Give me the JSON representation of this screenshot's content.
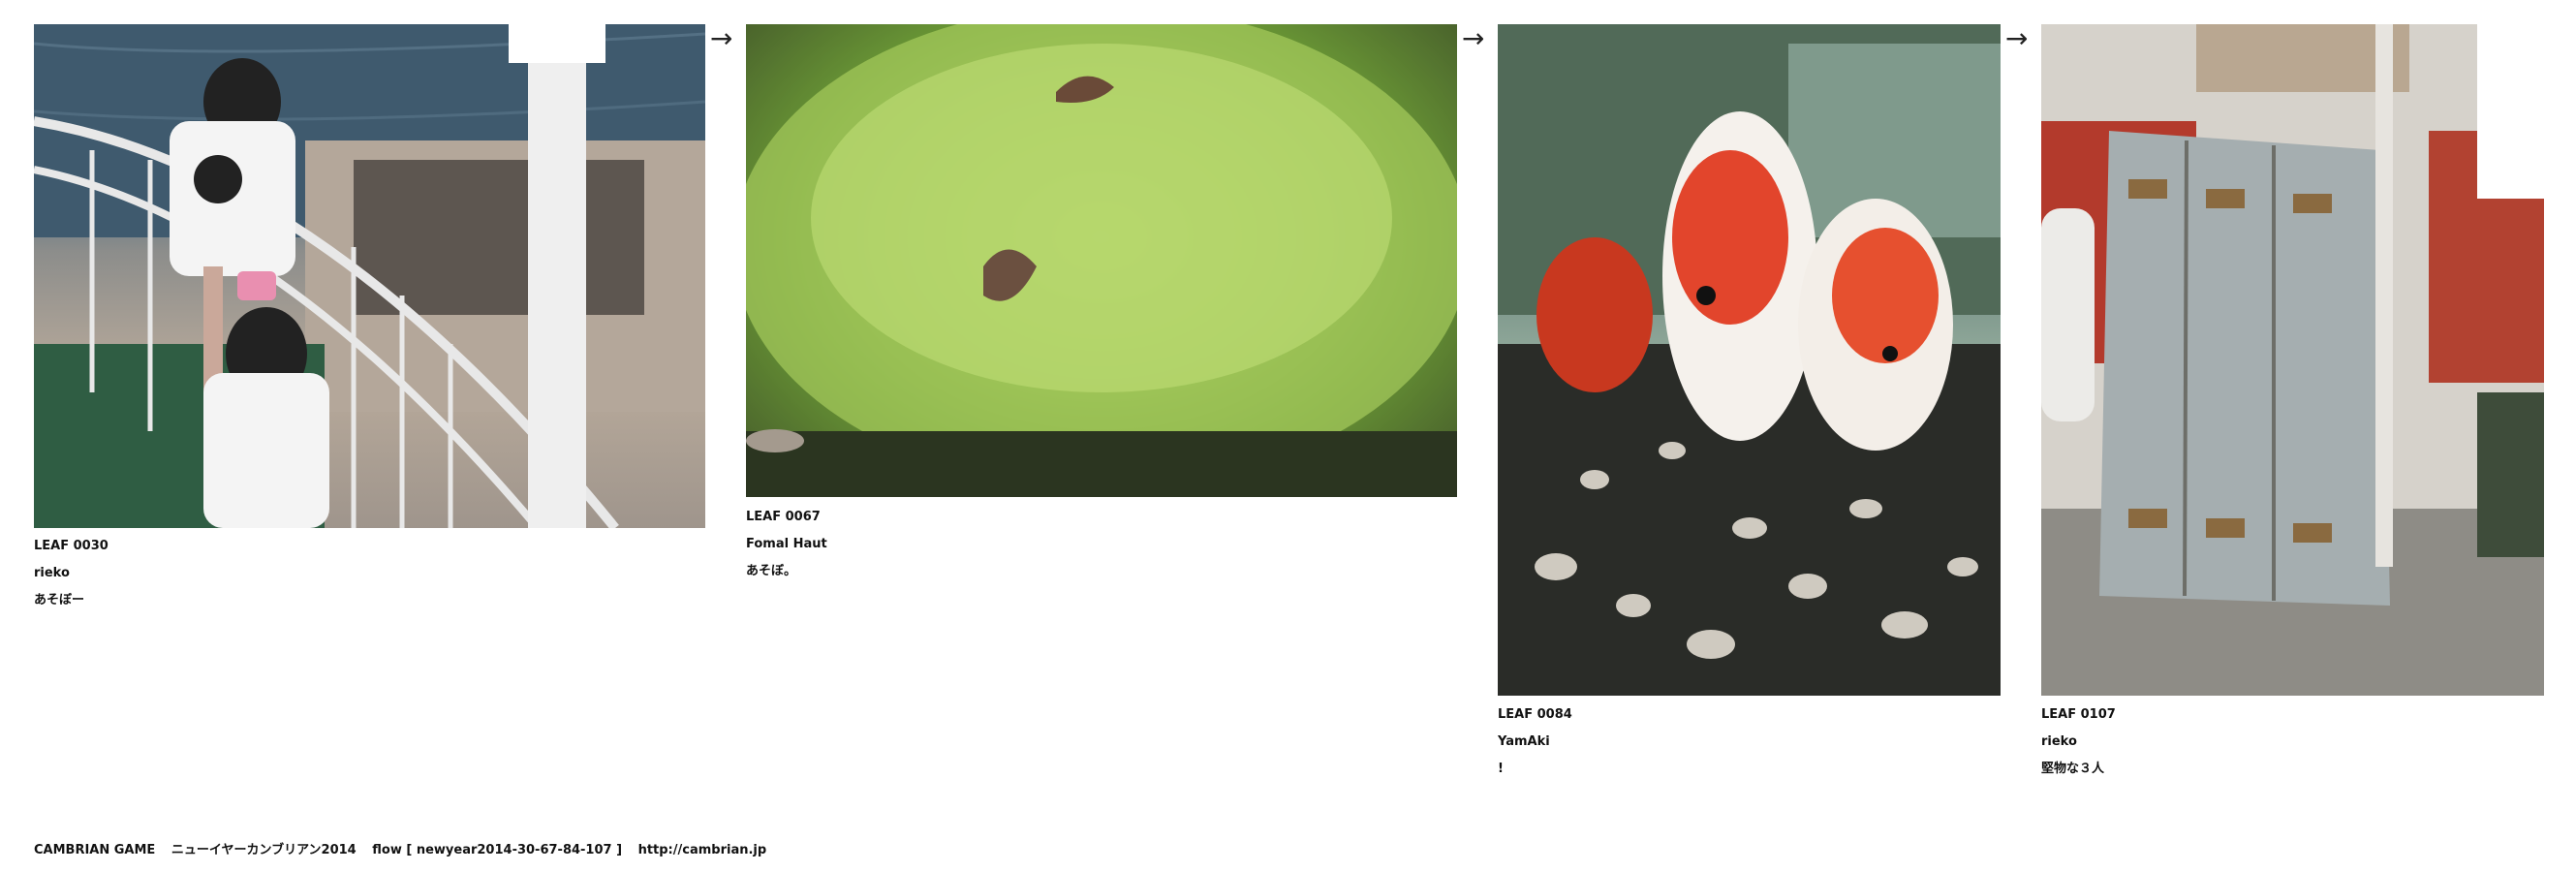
{
  "leaves": [
    {
      "id": "LEAF 0030",
      "author": "rieko",
      "caption": "あそぼー",
      "photo": "girls-on-ship-railing"
    },
    {
      "id": "LEAF 0067",
      "author": "Fomal Haut",
      "caption": "あそぼ。",
      "photo": "moss-with-leaves"
    },
    {
      "id": "LEAF 0084",
      "author": "YamAki",
      "caption": "!",
      "photo": "koi-in-aquarium"
    },
    {
      "id": "LEAF 0107",
      "author": "rieko",
      "caption": "堅物な３人",
      "photo": "three-old-lockers"
    }
  ],
  "arrows": [
    "→",
    "→",
    "→"
  ],
  "footer": {
    "site": "CAMBRIAN GAME",
    "title": "ニューイヤーカンブリアン2014",
    "flow": "flow [ newyear2014-30-67-84-107 ]",
    "url": "http://cambrian.jp"
  }
}
